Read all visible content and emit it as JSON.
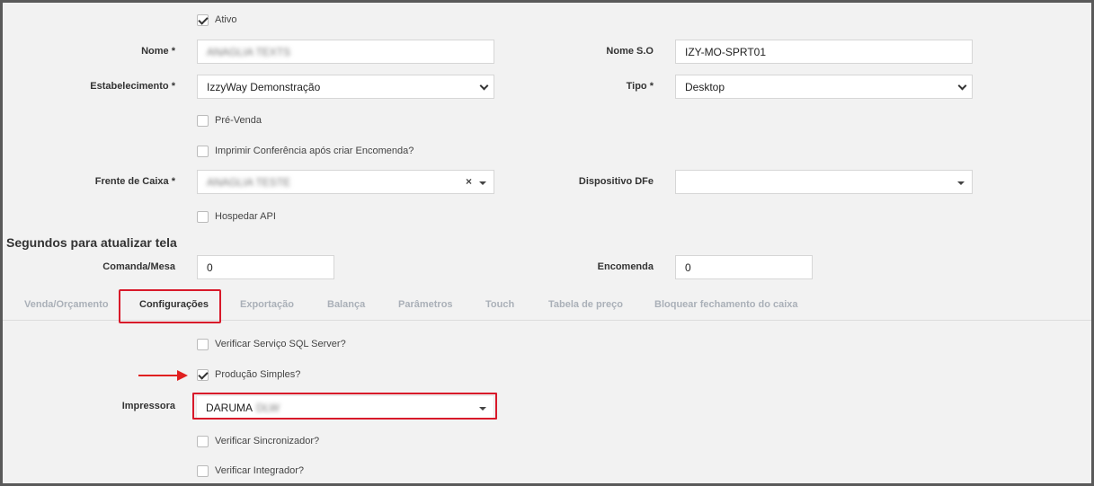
{
  "form": {
    "ativo_label": "Ativo",
    "nome_label": "Nome *",
    "nome_value": "ANAGLIA TEXTS",
    "nome_so_label": "Nome S.O",
    "nome_so_value": "IZY-MO-SPRT01",
    "estabelecimento_label": "Estabelecimento *",
    "estabelecimento_value": "IzzyWay Demonstração",
    "tipo_label": "Tipo *",
    "tipo_value": "Desktop",
    "pre_venda_label": "Pré-Venda",
    "imprimir_label": "Imprimir Conferência após criar Encomenda?",
    "frente_caixa_label": "Frente de Caixa *",
    "frente_caixa_value": "ANAGLIA TESTE",
    "clear_symbol": "×",
    "dispositivo_label": "Dispositivo DFe",
    "dispositivo_value": "",
    "hospedar_label": "Hospedar API"
  },
  "refresh": {
    "title": "Segundos para atualizar tela",
    "comanda_label": "Comanda/Mesa",
    "comanda_value": "0",
    "encomenda_label": "Encomenda",
    "encomenda_value": "0"
  },
  "tabs": [
    {
      "label": "Venda/Orçamento"
    },
    {
      "label": "Configurações"
    },
    {
      "label": "Exportação"
    },
    {
      "label": "Balança"
    },
    {
      "label": "Parâmetros"
    },
    {
      "label": "Touch"
    },
    {
      "label": "Tabela de preço"
    },
    {
      "label": "Bloquear fechamento do caixa"
    }
  ],
  "config": {
    "sql_label": "Verificar Serviço SQL Server?",
    "producao_label": "Produção Simples?",
    "impressora_label": "Impressora",
    "impressora_value": "DARUMA",
    "impressora_value_blur": "DLW",
    "sincronizador_label": "Verificar Sincronizador?",
    "integrador_label": "Verificar Integrador?"
  },
  "colors": {
    "highlight": "#d8192a",
    "background": "#f2f2f2"
  }
}
